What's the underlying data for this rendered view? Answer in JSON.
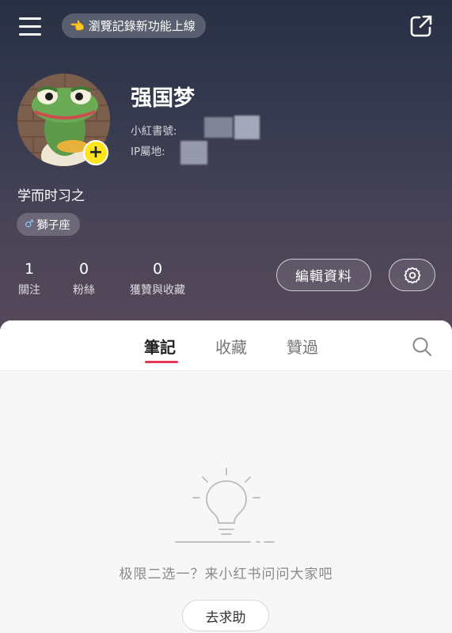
{
  "header": {
    "notice": "瀏覽記錄新功能上線",
    "notice_icon": "👈"
  },
  "profile": {
    "nickname": "强国梦",
    "id_label": "小紅書號:",
    "ip_label": "IP屬地:",
    "bio": "学而时习之",
    "zodiac_symbol": "♂",
    "zodiac": "獅子座",
    "avatar_add": "+"
  },
  "stats": [
    {
      "value": "1",
      "label": "關注"
    },
    {
      "value": "0",
      "label": "粉絲"
    },
    {
      "value": "0",
      "label": "獲贊與收藏"
    }
  ],
  "actions": {
    "edit_profile": "編輯資料"
  },
  "tabs": [
    {
      "label": "筆記",
      "active": true
    },
    {
      "label": "收藏",
      "active": false
    },
    {
      "label": "贊過",
      "active": false
    }
  ],
  "empty_state": {
    "message": "极限二选一？来小红书问问大家吧",
    "button": "去求助"
  },
  "colors": {
    "accent_red": "#e4364f",
    "avatar_badge": "#ffe41f"
  }
}
